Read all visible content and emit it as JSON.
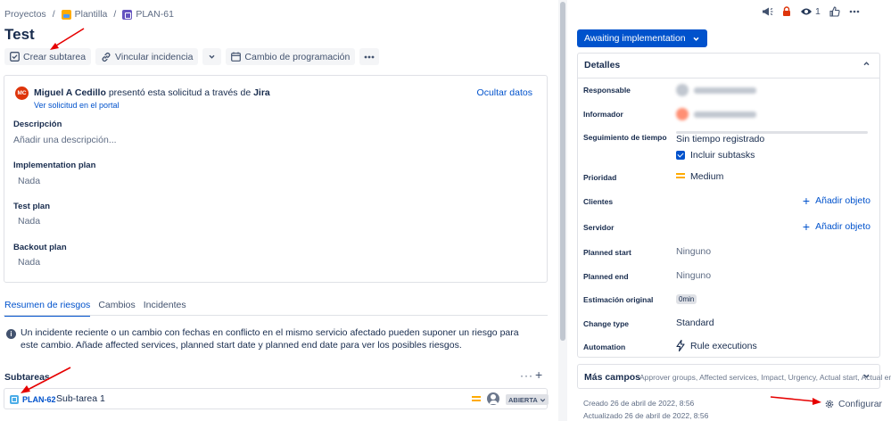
{
  "breadcrumb": {
    "projects": "Proyectos",
    "project": "Plantilla",
    "issue_key": "PLAN-61"
  },
  "issue": {
    "title": "Test"
  },
  "toolbar": {
    "create_subtask": "Crear subtarea",
    "link_issue": "Vincular incidencia",
    "schedule_change": "Cambio de programación"
  },
  "request": {
    "avatar_initials": "MC",
    "reporter_name": "Miguel A Cedillo",
    "submitted_via": "presentó esta solicitud a través de",
    "channel": "Jira",
    "portal_link": "Ver solicitud en el portal",
    "hide_data": "Ocultar datos",
    "fields": [
      {
        "label": "Descripción",
        "value": "Añadir una descripción..."
      },
      {
        "label": "Implementation plan",
        "value": "Nada"
      },
      {
        "label": "Test plan",
        "value": "Nada"
      },
      {
        "label": "Backout plan",
        "value": "Nada"
      }
    ]
  },
  "tabs": [
    {
      "label": "Resumen de riesgos",
      "active": true
    },
    {
      "label": "Cambios",
      "active": false
    },
    {
      "label": "Incidentes",
      "active": false
    }
  ],
  "risk_info": "Un incidente reciente o un cambio con fechas en conflicto en el mismo servicio afectado pueden suponer un riesgo para este cambio. Añade affected services, planned start date y planned end date para ver los posibles riesgos.",
  "subtasks": {
    "heading": "Subtareas",
    "items": [
      {
        "key": "PLAN-62",
        "summary": "Sub-tarea 1",
        "status": "ABIERTA"
      }
    ]
  },
  "sidebar": {
    "watch_count": "1",
    "status_button": "Awaiting implementation",
    "details_heading": "Detalles",
    "fields": {
      "assignee": {
        "label": "Responsable"
      },
      "reporter": {
        "label": "Informador"
      },
      "time_tracking": {
        "label": "Seguimiento de tiempo",
        "value": "Sin tiempo registrado",
        "include_subtasks": "Incluir subtasks"
      },
      "priority": {
        "label": "Prioridad",
        "value": "Medium"
      },
      "clients": {
        "label": "Clientes",
        "action": "Añadir objeto"
      },
      "server": {
        "label": "Servidor",
        "action": "Añadir objeto"
      },
      "planned_start": {
        "label": "Planned start",
        "value": "Ninguno"
      },
      "planned_end": {
        "label": "Planned end",
        "value": "Ninguno"
      },
      "original_estimate": {
        "label": "Estimación original",
        "value": "0min"
      },
      "change_type": {
        "label": "Change type",
        "value": "Standard"
      },
      "automation": {
        "label": "Automation",
        "value": "Rule executions"
      }
    },
    "more_fields": {
      "label": "Más campos",
      "list": "Approver groups, Affected services, Impact, Urgency, Actual start, Actual end"
    },
    "created": "Creado 26 de abril de 2022, 8:56",
    "updated": "Actualizado 26 de abril de 2022, 8:56",
    "configure": "Configurar"
  },
  "colors": {
    "primary": "#0052cc",
    "priority_medium": "#ffab00",
    "annotation_arrow": "#e60000",
    "text": "#172b4d",
    "subtle": "#5e6c84"
  }
}
